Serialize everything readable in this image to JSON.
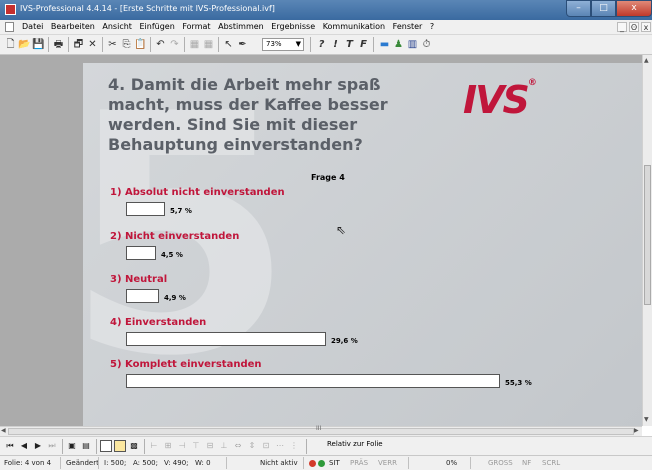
{
  "window": {
    "title": "IVS-Professional 4.4.14 - [Erste Schritte mit IVS-Professional.ivf]",
    "controls": {
      "minimize": "–",
      "maximize": "□",
      "close": "x"
    }
  },
  "menubar": {
    "items": [
      "Datei",
      "Bearbeiten",
      "Ansicht",
      "Einfügen",
      "Format",
      "Abstimmen",
      "Ergebnisse",
      "Kommunikation",
      "Fenster",
      "?"
    ],
    "mdi_controls": {
      "minimize": "_",
      "restore": "ʘ",
      "close": "x"
    }
  },
  "toolbar": {
    "zoom_value": "73%",
    "text_tools": [
      "?",
      "!",
      "T",
      "F"
    ]
  },
  "slide": {
    "question": "4. Damit die Arbeit mehr spaß macht, muss der Kaffee besser werden. Sind Sie mit dieser Behauptung einverstanden?",
    "logo": "IVS",
    "logo_mark": "®",
    "watermark": "5"
  },
  "chart_data": {
    "type": "bar",
    "title": "Frage 4",
    "categories": [
      "1) Absolut nicht einverstanden",
      "2) Nicht einverstanden",
      "3) Neutral",
      "4) Einverstanden",
      "5) Komplett einverstanden"
    ],
    "values": [
      5.7,
      4.5,
      4.9,
      29.6,
      55.3
    ],
    "value_labels": [
      "5,7 %",
      "4,5 %",
      "4,9 %",
      "29,6 %",
      "55,3 %"
    ],
    "unit": "%",
    "orientation": "horizontal",
    "xlim": [
      0,
      55.3
    ],
    "colors": {
      "label": "#c0163b",
      "bar_fill": "#ffffff",
      "bar_stroke": "#555555"
    }
  },
  "navbar": {
    "relative_button": "Relativ zur Folie"
  },
  "statusbar": {
    "slide": "Folie: 4 von 4",
    "modified": "Geändert",
    "i_count": "I: 500;",
    "a_count": "A: 500;",
    "v_count": "V: 490;",
    "w_count": "W: 0",
    "state": "Nicht aktiv",
    "sit": "SIT",
    "praes": "PRÄS",
    "verr": "VERR",
    "percent": "0%",
    "gross": "GROSS",
    "nf": "NF",
    "scrl": "SCRL"
  }
}
